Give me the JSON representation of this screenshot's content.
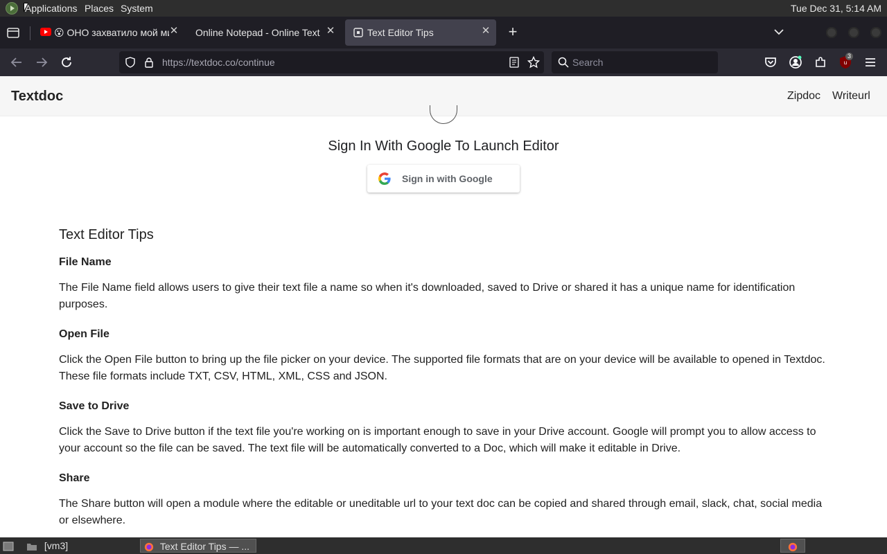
{
  "os_panel": {
    "menus": [
      "Applications",
      "Places",
      "System"
    ],
    "clock": "Tue Dec 31,  5:14 AM"
  },
  "browser": {
    "tabs": [
      {
        "title": "😮 ОНО захватило мой мир",
        "icon": "youtube-icon",
        "active": false
      },
      {
        "title": "Online Notepad - Online Text Editor",
        "icon": "none",
        "active": false
      },
      {
        "title": "Text Editor Tips",
        "icon": "textdoc-favicon",
        "active": true
      }
    ],
    "url_base": "https://textdoc.co",
    "url_path": "/continue",
    "search_placeholder": "Search",
    "extension_badge": "3"
  },
  "site": {
    "brand": "Textdoc",
    "nav": [
      "Zipdoc",
      "Writeurl"
    ],
    "sign_in_title": "Sign In With Google To Launch Editor",
    "google_button": "Sign in with Google"
  },
  "tips": {
    "heading": "Text Editor Tips",
    "sections": [
      {
        "title": "File Name",
        "body": "The File Name field allows users to give their text file a name so when it's downloaded, saved to Drive or shared it has a unique name for identification purposes."
      },
      {
        "title": "Open File",
        "body": "Click the Open File button to bring up the file picker on your device. The supported file formats that are on your device will be available to opened in Textdoc. These file formats include TXT, CSV, HTML, XML, CSS and JSON."
      },
      {
        "title": "Save to Drive",
        "body": "Click the Save to Drive button if the text file you're working on is important enough to save in your Drive account. Google will prompt you to allow access to your account so the file can be saved. The text file will be automatically converted to a Doc, which will make it editable in Drive."
      },
      {
        "title": "Share",
        "body": "The Share button will open a module where the editable or uneditable url to your text doc can be copied and shared through email, slack, chat, social media or elsewhere."
      }
    ]
  },
  "taskbar": {
    "items": [
      "[vm3]",
      "Text Editor Tips — ..."
    ]
  },
  "colors": {
    "panel": "#2e2e2e",
    "tabstrip": "#1f1e25",
    "navbar": "#2b2a33",
    "active_tab": "#42414d",
    "site_header": "#f6f6f6"
  }
}
